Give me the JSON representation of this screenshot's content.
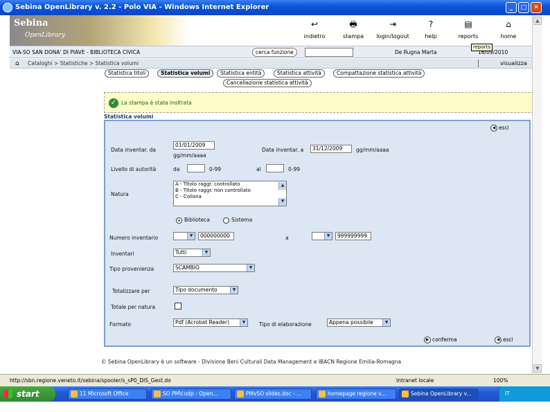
{
  "window": {
    "title": "Sebina OpenLibrary v. 2.2 - Polo VIA - Windows Internet Explorer",
    "buttons": [
      "_",
      "□",
      "✕"
    ]
  },
  "banner": {
    "logo_line1": "Sebina",
    "logo_line2": "OpenLibrary",
    "tools": [
      {
        "label": "indietro",
        "icon": "back-icon"
      },
      {
        "label": "stampa",
        "icon": "print-icon"
      },
      {
        "label": "login/logout",
        "icon": "login-icon"
      },
      {
        "label": "help",
        "icon": "help-icon"
      },
      {
        "label": "reports",
        "icon": "reports-icon"
      },
      {
        "label": "home",
        "icon": "home-icon"
      }
    ],
    "tooltip": "reports"
  },
  "libline": {
    "library": "VIA-SO SAN DONA' DI PIAVE - BIBLIOTECA CIVICA",
    "search_button": "cerca funzione",
    "user": "De Rugna Marta",
    "date": "16/09/2010"
  },
  "crumbs": {
    "path": "Cataloghi > Statistiche > Statistica volumi",
    "visualizza": "visualizza"
  },
  "tabs": [
    "Statistica titoli",
    "Statistica volumi",
    "Statistica entità",
    "Statistica attività",
    "Compattazione statistica attività",
    "Cancellazione statistica attività"
  ],
  "message": "La stampa è stata inoltrata",
  "form": {
    "title": "Statistica volumi",
    "esci": "esci",
    "conferma": "conferma",
    "data_da_label": "Data inventar. da",
    "data_da_value": "01/01/2009",
    "data_format_1": "gg/mm/aaaa",
    "data_a_label": "Data inventar. a",
    "data_a_value": "31/12/2009",
    "data_format_2": "gg/mm/aaaa",
    "livello_label": "Livello di autorità",
    "da_label": "da",
    "range_1": "0-99",
    "al_label": "al",
    "range_2": "0-99",
    "natura_label": "Natura",
    "natura_options": [
      "A - Titolo raggr. controllato",
      "B - Titolo raggr. non controllato",
      "C - Collana"
    ],
    "radio_biblioteca": "Biblioteca",
    "radio_sistema": "Sistema",
    "numero_label": "Numero inventario",
    "numero_da_value": "000000000",
    "numero_a_label": "a",
    "numero_a_value": "999999999",
    "inventari_label": "Inventari",
    "inventari_value": "Tutti",
    "tipo_prov_label": "Tipo provenienza",
    "tipo_prov_value": "SCAMBIO",
    "totalizzare_label": "Totalizzare per",
    "totalizzare_value": "Tipo documento",
    "totale_natura_label": "Totale per natura",
    "formato_label": "Formato",
    "formato_value": "Pdf (Acrobat Reader)",
    "tipo_elab_label": "Tipo di elaborazione",
    "tipo_elab_value": "Appena possibile"
  },
  "footer": "© Sebina OpenLibrary è un software - Divisione Beni Culturali Data Management e IBACN Regione Emilia-Romagna",
  "statusbar": {
    "url": "http://sbn.regione.veneto.it/sebina/spooler/s_sP0_DIS_Gest.do",
    "zone": "Intranet locale",
    "zoom": "100%"
  },
  "taskbar": {
    "start": "start",
    "tasks": [
      "11 Microsoft Office",
      "SO PMV.odp - Open...",
      "PMvSO slides.doc - ...",
      "homepage regione v...",
      "Sebina OpenLibrary v..."
    ],
    "tray_lang": "IT"
  }
}
